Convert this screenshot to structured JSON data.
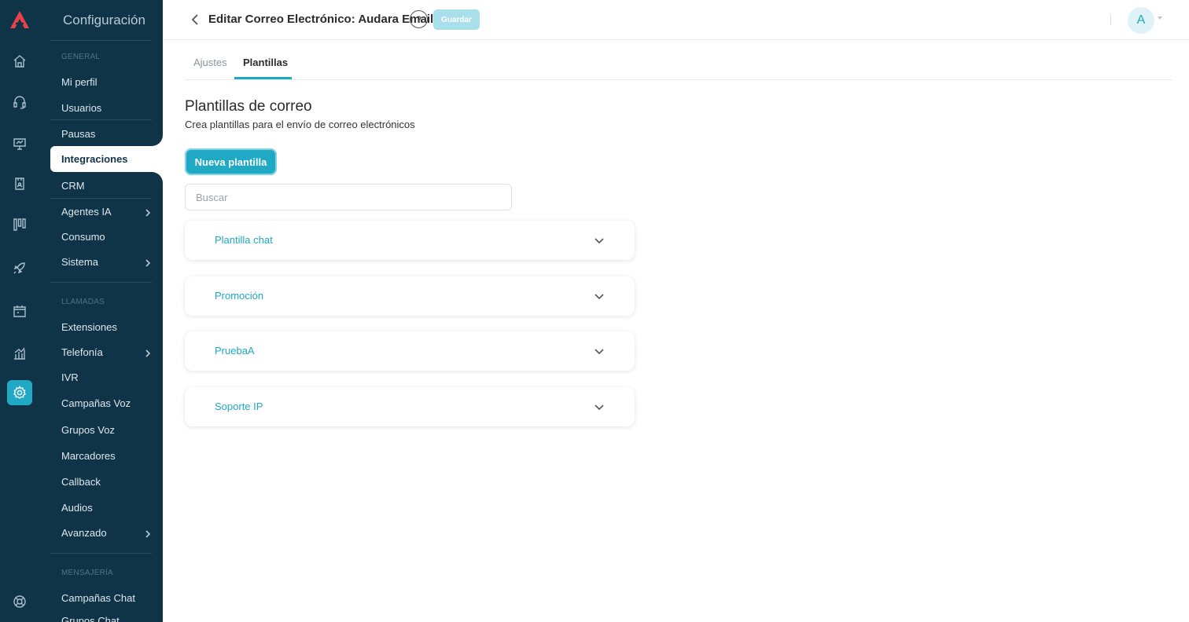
{
  "panel": {
    "title": "Configuración",
    "sections": {
      "general": "GENERAL",
      "llamadas": "LLAMADAS",
      "mensajeria": "MENSAJERÍA"
    },
    "items": {
      "mi_perfil": "Mi perfil",
      "usuarios": "Usuarios",
      "pausas": "Pausas",
      "integraciones": "Integraciones",
      "crm": "CRM",
      "agentes_ia": "Agentes IA",
      "consumo": "Consumo",
      "sistema": "Sistema",
      "extensiones": "Extensiones",
      "telefonia": "Telefonía",
      "ivr": "IVR",
      "campanas_voz": "Campañas Voz",
      "grupos_voz": "Grupos Voz",
      "marcadores": "Marcadores",
      "callback": "Callback",
      "audios": "Audios",
      "avanzado": "Avanzado",
      "campanas_chat": "Campañas Chat",
      "grupos_chat": "Grupos Chat"
    }
  },
  "header": {
    "title": "Editar Correo Electrónico: Audara Email",
    "help": "?",
    "save_label": "Guardar",
    "avatar_initial": "A"
  },
  "tabs": {
    "ajustes": "Ajustes",
    "plantillas": "Plantillas"
  },
  "main": {
    "heading": "Plantillas de correo",
    "subtitle": "Crea plantillas para el envío de correo electrónicos",
    "new_button": "Nueva plantilla",
    "search_placeholder": "Buscar",
    "templates": [
      "Plantilla chat",
      "Promoción",
      "PruebaA",
      "Soporte IP"
    ]
  },
  "colors": {
    "sidebar": "#0f3347",
    "accent": "#1fa9c4",
    "save_disabled": "#a9dfea"
  },
  "icons": [
    "audara-logo-icon",
    "home-icon",
    "headset-icon",
    "monitor-icon",
    "contacts-book-icon",
    "kanban-icon",
    "rocket-icon",
    "calendar-icon",
    "chart-icon",
    "gear-icon",
    "support-icon"
  ]
}
